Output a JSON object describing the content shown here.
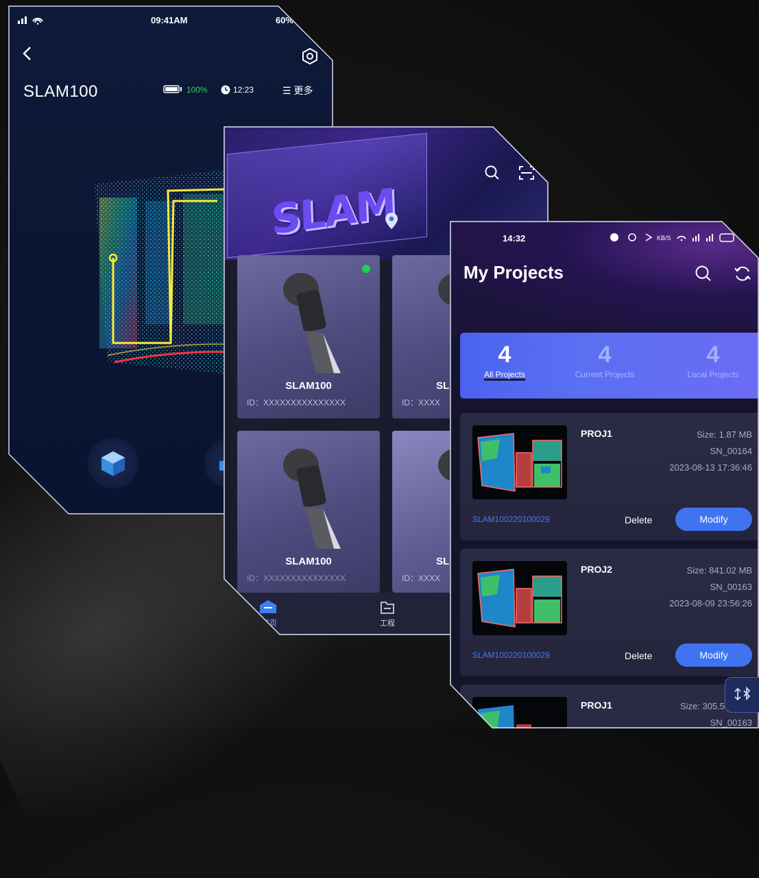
{
  "phone1": {
    "status_time": "09:41AM",
    "status_battery": "60%",
    "device_title": "SLAM100",
    "battery_percent": "100%",
    "clock": "12:23",
    "more_label": "更多"
  },
  "phone2": {
    "hero_text": "SLAM",
    "devices": [
      {
        "name": "SLAM100",
        "id": "ID：XXXXXXXXXXXXXXX",
        "online": true
      },
      {
        "name": "SL",
        "id": "ID：XXXX"
      },
      {
        "name": "SLAM100",
        "id": "ID：XXXXXXXXXXXXXXX"
      },
      {
        "name": "SL",
        "id": "ID：XXXX"
      }
    ],
    "tabs": [
      {
        "label": "首页",
        "icon": "home-icon"
      },
      {
        "label": "工程",
        "icon": "folder-icon"
      }
    ]
  },
  "phone3": {
    "status_time": "14:32",
    "title": "My Projects",
    "stats": [
      {
        "num": "4",
        "label": "All Projects"
      },
      {
        "num": "4",
        "label": "Current Projects"
      },
      {
        "num": "4",
        "label": "Local Projects"
      }
    ],
    "projects": [
      {
        "name": "PROJ1",
        "size": "Size: 1.87 MB",
        "sn": "SN_00164",
        "date": "2023-08-13 17:36:46",
        "device": "SLAM100220100029",
        "delete": "Delete",
        "modify": "Modify"
      },
      {
        "name": "PROJ2",
        "size": "Size: 841.02 MB",
        "sn": "SN_00163",
        "date": "2023-08-09 23:56:26",
        "device": "SLAM100220100029",
        "delete": "Delete",
        "modify": "Modify"
      },
      {
        "name": "PROJ1",
        "size": "Size: 305.5",
        "sn": "SN_00163"
      }
    ]
  },
  "colors": {
    "accent": "#3f73f0",
    "online": "#21d14a",
    "link": "#4b79e8"
  }
}
